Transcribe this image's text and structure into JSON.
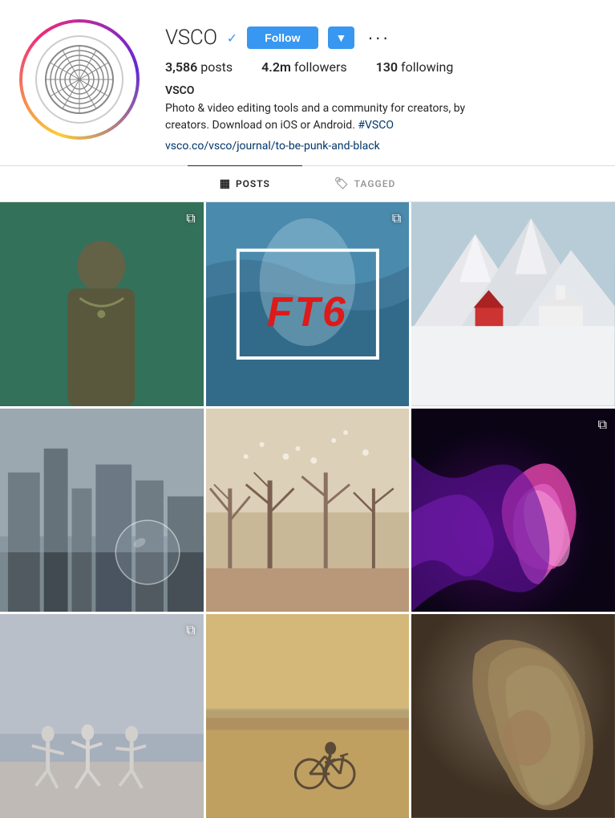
{
  "profile": {
    "username": "VSCO",
    "verified": true,
    "bio_name": "VSCO",
    "bio_text": "Photo & video editing tools and a community for creators, by creators. Download on iOS or Android.",
    "bio_hashtag": "#VSCO",
    "bio_link": "vsco.co/vsco/journal/to-be-punk-and-black",
    "stats": {
      "posts_label": "posts",
      "posts_count": "3,586",
      "followers_label": "followers",
      "followers_count": "4.2m",
      "following_label": "following",
      "following_count": "130"
    },
    "buttons": {
      "follow": "Follow",
      "more_dots": "···"
    }
  },
  "tabs": [
    {
      "id": "posts",
      "label": "POSTS",
      "active": true,
      "icon": "grid-icon"
    },
    {
      "id": "tagged",
      "label": "TAGGED",
      "active": false,
      "icon": "tag-icon"
    }
  ],
  "grid": {
    "items": [
      {
        "id": 1,
        "has_multi": true,
        "alt": "Person with chain necklace from behind"
      },
      {
        "id": 2,
        "has_multi": true,
        "alt": "Waterfall with FT6 text",
        "overlay": "FT6"
      },
      {
        "id": 3,
        "has_multi": false,
        "alt": "Snowy mountain village"
      },
      {
        "id": 4,
        "has_multi": false,
        "alt": "City skyline with bubble"
      },
      {
        "id": 5,
        "has_multi": false,
        "alt": "Winter trees with birds"
      },
      {
        "id": 6,
        "has_multi": true,
        "alt": "Purple pink swirl abstract"
      },
      {
        "id": 7,
        "has_multi": true,
        "alt": "People dancing on beach"
      },
      {
        "id": 8,
        "has_multi": false,
        "alt": "Person on bicycle on beach"
      },
      {
        "id": 9,
        "has_multi": false,
        "alt": "Person with flowing hair"
      }
    ]
  },
  "icons": {
    "verified": "✓",
    "chevron_down": "▾",
    "multi_photo": "⧉",
    "grid": "▦",
    "tag": "🏷"
  }
}
